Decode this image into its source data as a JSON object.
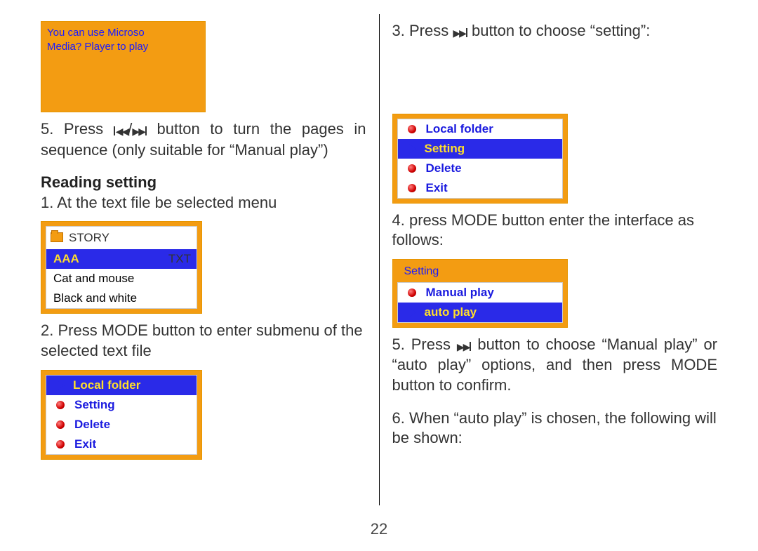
{
  "page_number": "22",
  "left": {
    "screen_text_line1": "You can use Microso",
    "screen_text_line2": "Media? Player to play",
    "step5_a": "5. Press ",
    "step5_b": " button to turn the pages in sequence (only suitable for “Manual play”)",
    "heading": "Reading setting",
    "step1": "1. At the text file be selected menu",
    "story_menu": {
      "title": "STORY",
      "row1_label": "AAA",
      "row1_ext": "TXT",
      "row2_label": "Cat and mouse",
      "row3_label": "Black and white"
    },
    "step2": "2. Press MODE button to enter submenu of the selected text file",
    "submenu": {
      "row1": "Local folder",
      "row2": "Setting",
      "row3": "Delete",
      "row4": "Exit"
    }
  },
  "right": {
    "step3_a": "3. Press ",
    "step3_b": " button to choose  “setting”:",
    "submenu": {
      "row1": "Local folder",
      "row2": "Setting",
      "row3": "Delete",
      "row4": "Exit"
    },
    "step4": "4. press MODE button enter the interface as follows:",
    "setting_menu": {
      "title": "Setting",
      "row1": "Manual play",
      "row2": "auto play"
    },
    "step5_a": "5. Press ",
    "step5_b": " button to choose “Manual play” or “auto play”  options, and then press MODE button to confirm.",
    "step6": "6. When “auto play” is chosen, the following will be shown:"
  }
}
